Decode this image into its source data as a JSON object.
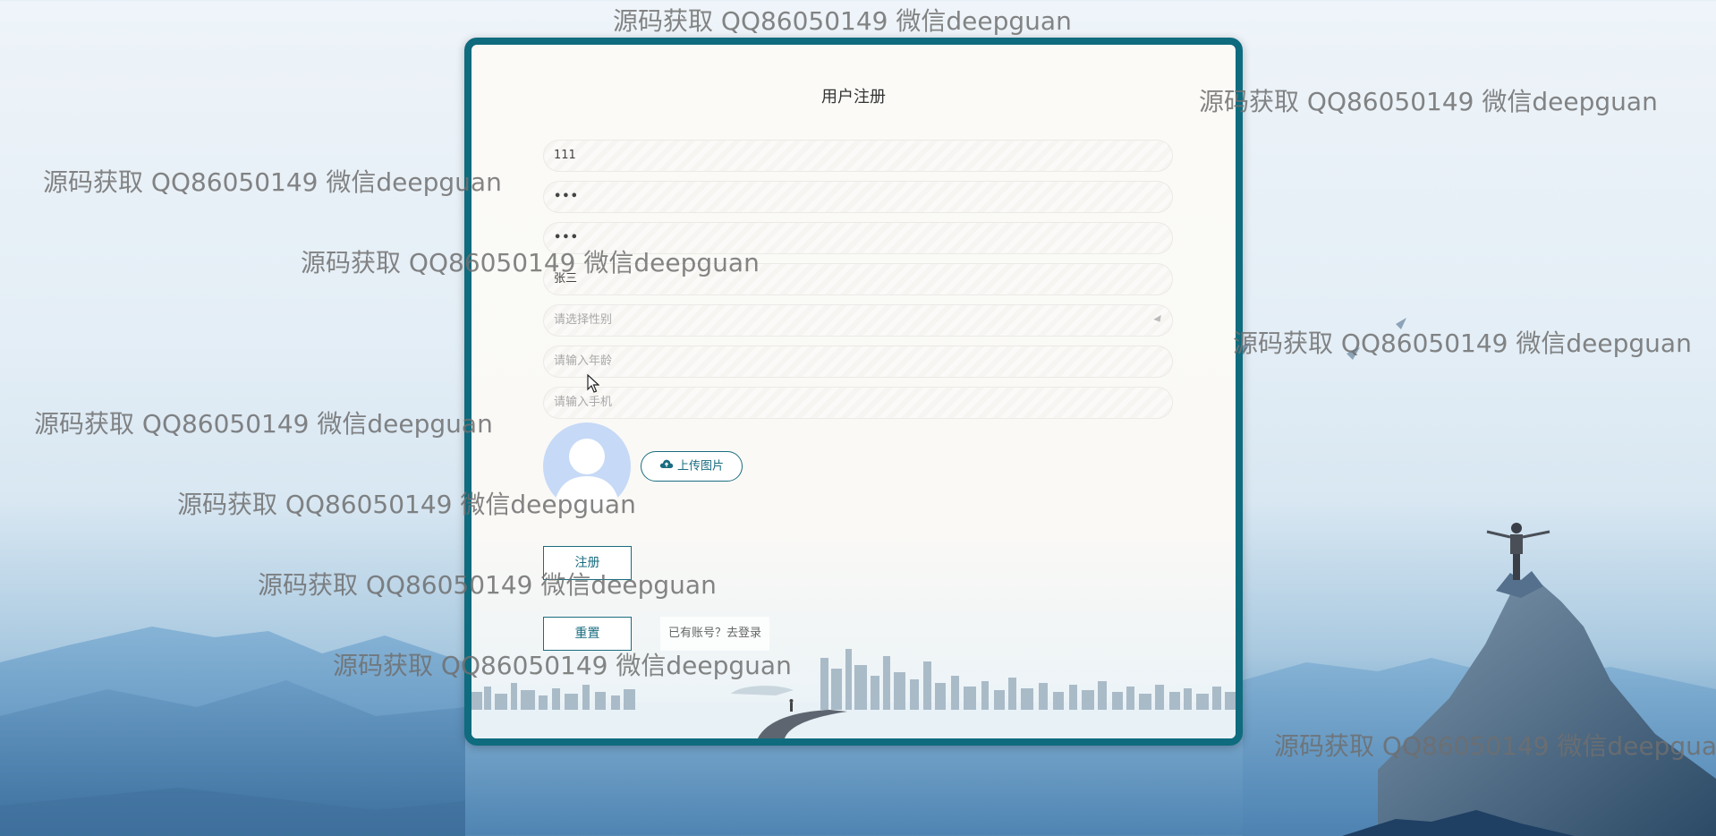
{
  "form": {
    "title": "用户注册",
    "username_value": "111",
    "password_value": "•••",
    "confirm_password_value": "•••",
    "name_value": "张三",
    "gender_placeholder": "请选择性别",
    "age_placeholder": "请输入年龄",
    "phone_placeholder": "请输入手机",
    "upload_label": "上传图片",
    "register_label": "注册",
    "reset_label": "重置",
    "login_link": "已有账号？去登录"
  },
  "watermark": {
    "text": "源码获取 QQ86050149 微信deepguan"
  },
  "colors": {
    "accent": "#0f6b7e",
    "avatar_bg": "#c6d9f6"
  }
}
